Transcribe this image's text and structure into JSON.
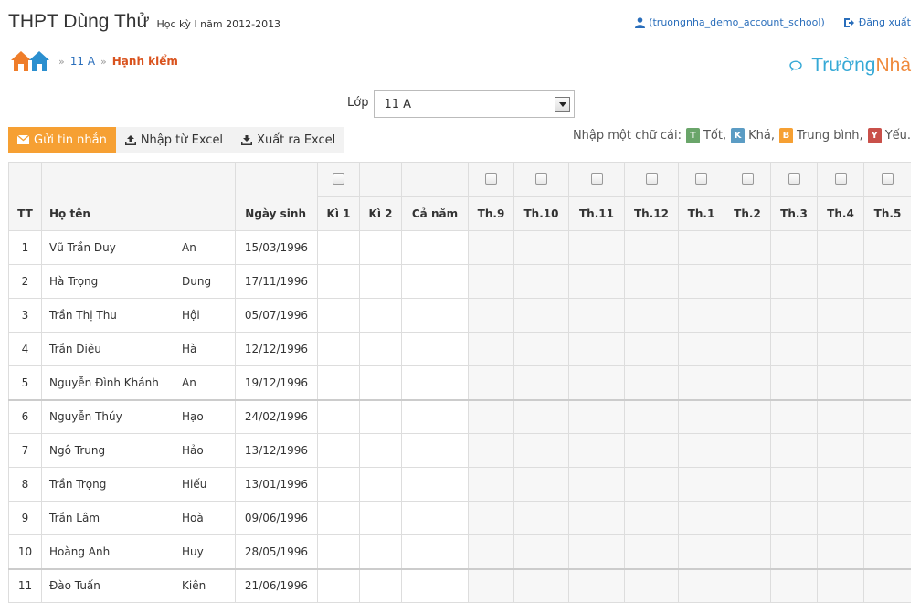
{
  "header": {
    "school_name": "THPT Dùng Thử",
    "term": "Học kỳ I năm 2012-2013",
    "user": "(truongnha_demo_account_school)",
    "logout": "Đăng xuất"
  },
  "breadcrumb": {
    "class": "11 A",
    "current": "Hạnh kiểm",
    "separator": "»"
  },
  "brand": {
    "part1": "Trường",
    "part2": "Nhà",
    "color1": "#36a9d6",
    "color2": "#ef8a3c"
  },
  "class_select": {
    "label": "Lớp",
    "value": "11 A"
  },
  "toolbar": {
    "send_message": "Gửi tin nhắn",
    "import_excel": "Nhập từ Excel",
    "export_excel": "Xuất ra Excel"
  },
  "legend": {
    "prompt": "Nhập một chữ cái:",
    "items": [
      {
        "letter": "T",
        "label": "Tốt,",
        "color": "#6aa56a"
      },
      {
        "letter": "K",
        "label": "Khá,",
        "color": "#5b9cc4"
      },
      {
        "letter": "B",
        "label": "Trung bình,",
        "color": "#f6a033"
      },
      {
        "letter": "Y",
        "label": "Yếu.",
        "color": "#c9504a"
      }
    ]
  },
  "table": {
    "headers": {
      "tt": "TT",
      "name": "Họ tên",
      "dob": "Ngày sinh",
      "marks": [
        "Kì 1",
        "Kì 2",
        "Cả năm"
      ],
      "months": [
        "Th.9",
        "Th.10",
        "Th.11",
        "Th.12",
        "Th.1",
        "Th.2",
        "Th.3",
        "Th.4",
        "Th.5"
      ]
    },
    "rows": [
      {
        "tt": "1",
        "last": "Vũ Trần Duy",
        "first": "An",
        "dob": "15/03/1996"
      },
      {
        "tt": "2",
        "last": "Hà Trọng",
        "first": "Dung",
        "dob": "17/11/1996"
      },
      {
        "tt": "3",
        "last": "Trần Thị Thu",
        "first": "Hội",
        "dob": "05/07/1996"
      },
      {
        "tt": "4",
        "last": "Trần Diệu",
        "first": "Hà",
        "dob": "12/12/1996"
      },
      {
        "tt": "5",
        "last": "Nguyễn Đình Khánh",
        "first": "An",
        "dob": "19/12/1996"
      },
      {
        "tt": "6",
        "last": "Nguyễn Thúy",
        "first": "Hạo",
        "dob": "24/02/1996"
      },
      {
        "tt": "7",
        "last": "Ngô Trung",
        "first": "Hảo",
        "dob": "13/12/1996"
      },
      {
        "tt": "8",
        "last": "Trần Trọng",
        "first": "Hiếu",
        "dob": "13/01/1996"
      },
      {
        "tt": "9",
        "last": "Trần Lâm",
        "first": "Hoà",
        "dob": "09/06/1996"
      },
      {
        "tt": "10",
        "last": "Hoàng Anh",
        "first": "Huy",
        "dob": "28/05/1996"
      },
      {
        "tt": "11",
        "last": "Đào Tuấn",
        "first": "Kiên",
        "dob": "21/06/1996"
      }
    ]
  }
}
